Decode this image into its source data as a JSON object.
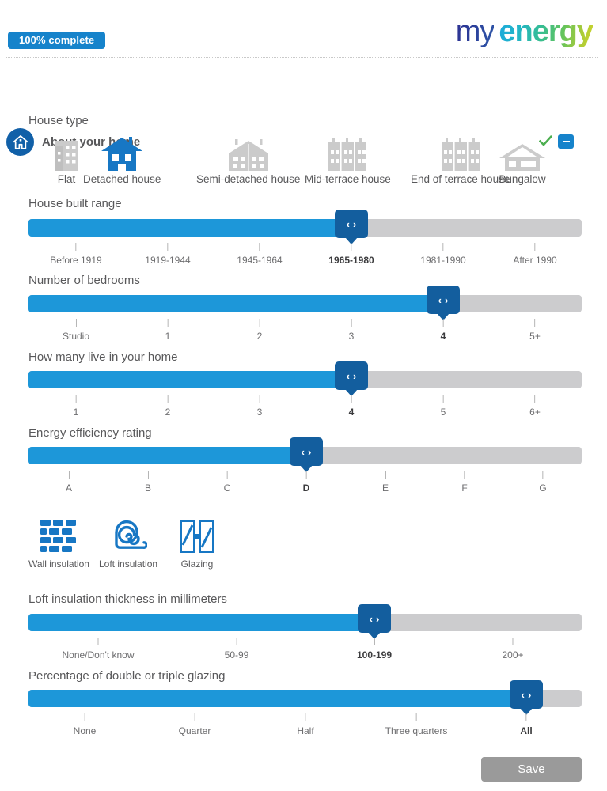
{
  "header": {
    "progress_label": "100% complete",
    "logo_my": "my",
    "logo_energy": "energy",
    "section_title": "About your home",
    "check_icon": "check-icon",
    "collapse_icon": "minus-icon",
    "home_icon": "home-icon"
  },
  "colors": {
    "accent_blue": "#1683cb",
    "track_fill": "#1d97d9",
    "track_bg": "#ccccce",
    "handle": "#135e9e",
    "icon_gray": "#cccccc",
    "icon_blue": "#1777c4",
    "check_green": "#4caf50",
    "save_gray": "#9a9a9a"
  },
  "house_type": {
    "label": "House type",
    "selected_index": 1,
    "options": [
      {
        "label": "Flat",
        "icon": "flat-icon"
      },
      {
        "label": "Detached house",
        "icon": "detached-house-icon"
      },
      {
        "label": "Semi-detached house",
        "icon": "semi-detached-house-icon"
      },
      {
        "label": "Mid-terrace house",
        "icon": "mid-terrace-house-icon"
      },
      {
        "label": "End of terrace house",
        "icon": "end-of-terrace-house-icon"
      },
      {
        "label": "Bungalow",
        "icon": "bungalow-icon"
      }
    ]
  },
  "sliders": [
    {
      "id": "house-built-range",
      "label": "House built range",
      "options": [
        "Before 1919",
        "1919-1944",
        "1945-1964",
        "1965-1980",
        "1981-1990",
        "After 1990"
      ],
      "selected_index": 3,
      "value": "1965-1980"
    },
    {
      "id": "number-of-bedrooms",
      "label": "Number of bedrooms",
      "options": [
        "Studio",
        "1",
        "2",
        "3",
        "4",
        "5+"
      ],
      "selected_index": 4,
      "value": "4"
    },
    {
      "id": "how-many-live-in-your-home",
      "label": "How many live in your home",
      "options": [
        "1",
        "2",
        "3",
        "4",
        "5",
        "6+"
      ],
      "selected_index": 3,
      "value": "4"
    },
    {
      "id": "energy-efficiency-rating",
      "label": "Energy efficiency rating",
      "options": [
        "A",
        "B",
        "C",
        "D",
        "E",
        "F",
        "G"
      ],
      "selected_index": 3,
      "value": "D"
    },
    {
      "id": "loft-insulation-thickness",
      "label": "Loft insulation thickness in millimeters",
      "options": [
        "None/Don't know",
        "50-99",
        "100-199",
        "200+"
      ],
      "selected_index": 2,
      "value": "100-199"
    },
    {
      "id": "percentage-of-glazing",
      "label": "Percentage of double or triple glazing",
      "options": [
        "None",
        "Quarter",
        "Half",
        "Three quarters",
        "All"
      ],
      "selected_index": 4,
      "value": "All"
    }
  ],
  "features": [
    {
      "label": "Wall insulation",
      "icon": "brick-wall-icon"
    },
    {
      "label": "Loft insulation",
      "icon": "insulation-roll-icon"
    },
    {
      "label": "Glazing",
      "icon": "window-glazing-icon"
    }
  ],
  "handle": {
    "left_chevron": "‹",
    "right_chevron": "›"
  },
  "footer": {
    "save_label": "Save"
  }
}
